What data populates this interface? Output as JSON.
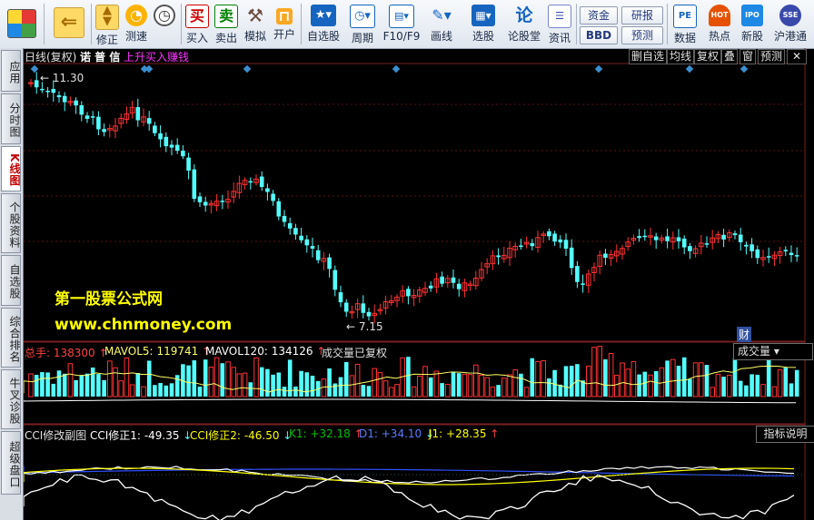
{
  "toolbar": {
    "left_buttons": [
      {
        "label": "修正",
        "icon": "up-down-arrows-icon"
      },
      {
        "label": "测速",
        "icon": "speed-dial-icon"
      },
      {
        "label": "",
        "icon": "clock-icon"
      },
      {
        "label": "买入",
        "icon": "buy-icon",
        "glyph": "买"
      },
      {
        "label": "卖出",
        "icon": "sell-icon",
        "glyph": "卖"
      },
      {
        "label": "模拟",
        "icon": "hammer-icon"
      },
      {
        "label": "开户",
        "icon": "lock-icon"
      },
      {
        "label": "自选股",
        "icon": "star-list-icon"
      },
      {
        "label": "周期",
        "icon": "period-clock-icon"
      },
      {
        "label": "F10/F9",
        "icon": "f10-icon"
      },
      {
        "label": "画线",
        "icon": "pen-icon"
      },
      {
        "label": "选股",
        "icon": "stock-pick-icon"
      },
      {
        "label": "论股堂",
        "icon": "forum-icon",
        "glyph": "论"
      },
      {
        "label": "资讯",
        "icon": "news-icon"
      }
    ],
    "mini_buttons": [
      "资金",
      "BBD",
      "研报",
      "预测"
    ],
    "right_buttons": [
      {
        "label": "数据",
        "icon": "data-icon",
        "glyph": "PE"
      },
      {
        "label": "热点",
        "icon": "hot-icon",
        "glyph": "HOT"
      },
      {
        "label": "新股",
        "icon": "ipo-icon",
        "glyph": "IPO"
      },
      {
        "label": "沪港通",
        "icon": "hk-link-icon",
        "glyph": "SSE"
      }
    ]
  },
  "sidebar": {
    "tabs": [
      "应用",
      "分时图",
      "K线图",
      "个股资料",
      "自选股",
      "综合排名",
      "牛叉诊股",
      "超级盘口"
    ],
    "active": 2
  },
  "header": {
    "period": "日线(复权)",
    "stock_name": "诺 普 信",
    "signal": "上升买入赚钱",
    "right_buttons": [
      "删自选",
      "均线",
      "复权",
      "叠",
      "窗",
      "预测"
    ]
  },
  "price_labels": {
    "high": "11.30",
    "low": "7.15"
  },
  "watermark": {
    "line1": "第一股票公式网",
    "line2": "www.chnmoney.com"
  },
  "finance_badge": "财",
  "volume_panel": {
    "total_label": "总手:",
    "total_value": "138300",
    "ma5_label": "MAVOL5:",
    "ma5_value": "119741",
    "ma120_label": "MAVOL120:",
    "ma120_value": "134126",
    "note": "成交量已复权",
    "selector": "成交量"
  },
  "cci_panel": {
    "title": "CCI修改副图",
    "cci1_label": "CCI修正1:",
    "cci1_value": "-49.35",
    "cci2_label": "CCI修正2:",
    "cci2_value": "-46.50",
    "k_label": "K1:",
    "k_value": "+32.18",
    "d_label": "D1:",
    "d_value": "+34.10",
    "j_label": "J1:",
    "j_value": "+28.35",
    "help_button": "指标说明"
  },
  "colors": {
    "up": "#ff3232",
    "down": "#54ffff",
    "accent": "#ff00ff",
    "background": "#000000"
  }
}
